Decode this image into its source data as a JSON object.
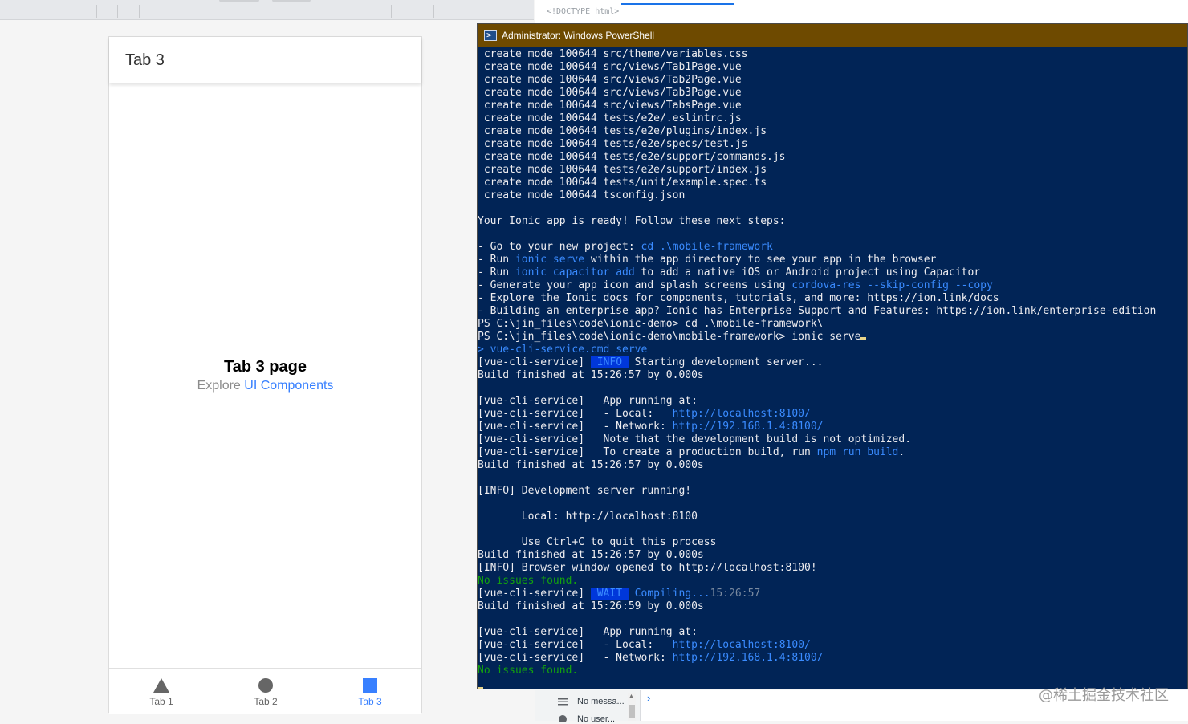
{
  "devtools": {
    "top_code": "<!DOCTYPE html>",
    "bottom_rows": [
      "No messa...",
      "No user..."
    ]
  },
  "phone": {
    "header_title": "Tab 3",
    "page_title": "Tab 3 page",
    "explore_text": "Explore",
    "explore_link": "UI Components",
    "tabs": [
      {
        "label": "Tab 1",
        "icon": "triangle-icon"
      },
      {
        "label": "Tab 2",
        "icon": "circle-icon"
      },
      {
        "label": "Tab 3",
        "icon": "square-icon",
        "active": true
      }
    ],
    "accent_color": "#3880ff"
  },
  "powershell": {
    "title": "Administrator: Windows PowerShell",
    "titlebar_color": "#6e4a00",
    "background_color": "#012456",
    "lines": [
      " create mode 100644 src/theme/variables.css",
      " create mode 100644 src/views/Tab1Page.vue",
      " create mode 100644 src/views/Tab2Page.vue",
      " create mode 100644 src/views/Tab3Page.vue",
      " create mode 100644 src/views/TabsPage.vue",
      " create mode 100644 tests/e2e/.eslintrc.js",
      " create mode 100644 tests/e2e/plugins/index.js",
      " create mode 100644 tests/e2e/specs/test.js",
      " create mode 100644 tests/e2e/support/commands.js",
      " create mode 100644 tests/e2e/support/index.js",
      " create mode 100644 tests/unit/example.spec.ts",
      " create mode 100644 tsconfig.json",
      "",
      "Your Ionic app is ready! Follow these next steps:",
      "",
      "- Go to your new project: ",
      "- Run ",
      "- Run ",
      "- Generate your app icon and splash screens using ",
      "- Explore the Ionic docs for components, tutorials, and more: https://ion.link/docs",
      "- Building an enterprise app? Ionic has Enterprise Support and Features: https://ion.link/enterprise-edition",
      "PS C:\\jin_files\\code\\ionic-demo> cd .\\mobile-framework\\",
      "PS C:\\jin_files\\code\\ionic-demo\\mobile-framework> ionic serve",
      "> ",
      "[vue-cli-service] ",
      "Build finished at 15:26:57 by 0.000s",
      "",
      "[vue-cli-service]   App running at:",
      "[vue-cli-service]   - Local:   ",
      "[vue-cli-service]   - Network: ",
      "[vue-cli-service]   Note that the development build is not optimized.",
      "[vue-cli-service]   To create a production build, run ",
      "Build finished at 15:26:57 by 0.000s",
      "",
      "[INFO] Development server running!",
      "",
      "       Local: http://localhost:8100",
      "",
      "       Use Ctrl+C to quit this process",
      "Build finished at 15:26:57 by 0.000s",
      "[INFO] Browser window opened to http://localhost:8100!",
      "No issues found.",
      "[vue-cli-service] ",
      "Build finished at 15:26:59 by 0.000s",
      "",
      "[vue-cli-service]   App running at:",
      "[vue-cli-service]   - Local:   ",
      "[vue-cli-service]   - Network: ",
      "No issues found."
    ],
    "spans": {
      "cd_target": "cd .\\mobile-framework",
      "run1_cmd": "ionic serve",
      "run1_rest": " within the app directory to see your app in the browser",
      "run2_cmd": "ionic capacitor add",
      "run2_rest": " to add a native iOS or Android project using Capacitor",
      "res_cmd": "cordova-res --skip-config --copy",
      "vue_cmd": "vue-cli-service.cmd serve",
      "info_badge": " INFO ",
      "starting": " Starting development server...",
      "local_url": "http://localhost:8100/",
      "network_url": "http://192.168.1.4:8100/",
      "npm_cmd": "npm run build",
      "wait_badge": " WAIT ",
      "compiling": " Compiling...",
      "compile_time": "15:26:57"
    }
  },
  "watermark": "@稀土掘金技术社区"
}
